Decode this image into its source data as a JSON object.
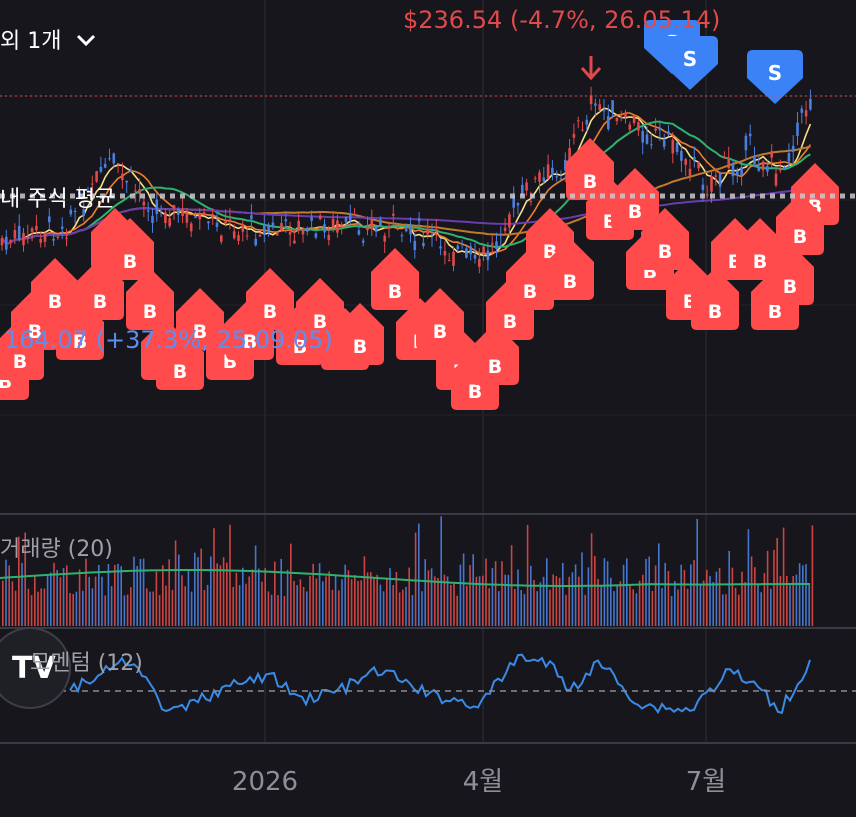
{
  "header": {
    "interval_label": "외 1개",
    "chevron_icon": "chevron-down-icon"
  },
  "price_annotations": {
    "high_label": "$236.54 (-4.7%, 26.05.14)",
    "low_label": "164.07 (+37.3%, 25.09.05)",
    "avg_cost_label": "내 주식 평균"
  },
  "volume_label": "거래량 (20)",
  "momentum_label": "모멘텀 (12)",
  "watermark_text": "TV",
  "x_axis": {
    "ticks": [
      "2026",
      "4월",
      "7월"
    ]
  },
  "colors": {
    "background": "#16161c",
    "up": "#e04a4a",
    "down": "#4a7fe0",
    "buy_marker": "#ff4b4b",
    "sell_marker": "#3b82f6",
    "ma5": "#f7e08a",
    "ma10": "#ee7f2d",
    "ma20": "#2fb170",
    "ma60": "#c07a2c",
    "ma120": "#6a3cb0",
    "momentum": "#3a8be6"
  },
  "chart_data": [
    {
      "type": "candlestick",
      "title": "",
      "ylim": [
        150,
        245
      ],
      "price_line": 236.54,
      "avg_cost_line": 215.0,
      "markers": {
        "buy_label": "B",
        "sell_label": "S",
        "buy_count": 42,
        "sell_count": 3
      },
      "moving_averages": [
        "ma5",
        "ma10",
        "ma20",
        "ma60",
        "ma120"
      ],
      "grid": true
    },
    {
      "type": "bar",
      "name": "거래량 (20)",
      "series": [
        {
          "name": "거래량 MA 20"
        }
      ]
    },
    {
      "type": "line",
      "name": "모멘텀 (12)",
      "zero_line": 0
    }
  ]
}
